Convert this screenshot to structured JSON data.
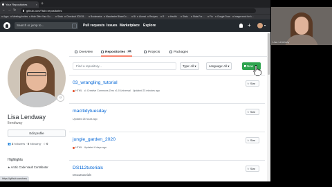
{
  "browser": {
    "tab_title": "Your Repositories",
    "tab_close": "×",
    "new_tab": "+",
    "url": "github.com/?tab=repositories",
    "back": "←",
    "forward": "→",
    "reload": "↻",
    "bookmarks": [
      "Apps",
      "Meeting Invites",
      "Hide Offer Your Su…",
      "Slack",
      "Checkout 2020 B…",
      "Bookmarks",
      "Macalester BlazeGo…",
      "Bt",
      "Alumni",
      "Recipes",
      "R",
      "Health",
      "Stats",
      "Stats For…",
      "Fin",
      "Google Docs",
      "Image recut for k…"
    ]
  },
  "github": {
    "search_placeholder": "Search or jump to...",
    "search_key": "/",
    "nav": [
      "Pull requests",
      "Issues",
      "Marketplace",
      "Explore"
    ],
    "plus": "+",
    "caret": "▾"
  },
  "profile": {
    "status_emoji": "☺",
    "full_name": "Lisa Lendway",
    "login": "llendway",
    "edit_button": "Edit profile",
    "followers_count": "2",
    "followers_label": "followers",
    "following_count": "0",
    "following_label": "following",
    "stars_count": "0",
    "sep": "·",
    "highlights_title": "Highlights",
    "highlights_item": "★ Arctic Code Vault Contributor"
  },
  "tabs": [
    {
      "label": "Overview",
      "count": ""
    },
    {
      "label": "Repositories",
      "count": "28"
    },
    {
      "label": "Projects",
      "count": ""
    },
    {
      "label": "Packages",
      "count": ""
    }
  ],
  "filter": {
    "placeholder": "Find a repository...",
    "type_label": "Type: All ▾",
    "language_label": "Language: All ▾",
    "new_label": "New"
  },
  "repos": [
    {
      "name": "03_wrangling_tutorial",
      "description": "",
      "lang": "HTML",
      "license": "Creative Commons Zero v1.0 Universal",
      "updated": "Updated 23 minutes ago",
      "star": "☆ Star"
    },
    {
      "name": "macltidytuesday",
      "description": "",
      "lang": "",
      "license": "",
      "updated": "Updated 26 hours ago",
      "star": "☆ Star"
    },
    {
      "name": "jungle_garden_2020",
      "description": "",
      "lang": "HTML",
      "license": "",
      "updated": "Updated 6 days ago",
      "star": "☆ Star"
    },
    {
      "name": "DS112tutorials",
      "description": "DS112tutorials",
      "lang": "",
      "license": "",
      "updated": "",
      "star": "☆ Star"
    }
  ],
  "statusbar": "https://github.com/new",
  "camera": {
    "name": "Lisa Lendway"
  },
  "colors": {
    "github_header": "#24292e",
    "new_button": "#2ea44f",
    "link": "#0366d6",
    "active_tab": "#f9826c"
  }
}
